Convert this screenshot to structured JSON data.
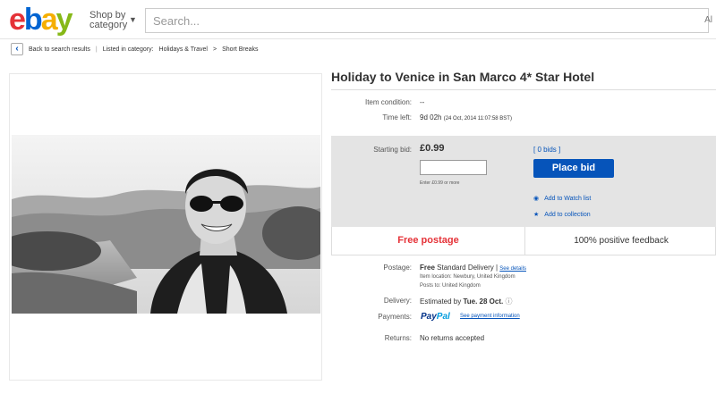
{
  "header": {
    "logo_letters": [
      {
        "ch": "e",
        "color": "#e53238"
      },
      {
        "ch": "b",
        "color": "#0064d2"
      },
      {
        "ch": "a",
        "color": "#f5af02"
      },
      {
        "ch": "y",
        "color": "#86b817"
      }
    ],
    "shop_by_line1": "Shop by",
    "shop_by_line2": "category",
    "search_placeholder": "Search...",
    "search_right": "Al"
  },
  "breadcrumb": {
    "back": "Back to search results",
    "listed_in": "Listed in category:",
    "cat1": "Holidays & Travel",
    "arrow": ">",
    "cat2": "Short Breaks"
  },
  "item": {
    "title": "Holiday to Venice in San Marco 4* Star Hotel",
    "condition_label": "Item condition:",
    "condition_value": "--",
    "time_left_label": "Time left:",
    "time_left_value": "9d 02h",
    "time_left_detail": "(24 Oct, 2014   11:07:58 BST)"
  },
  "bid": {
    "starting_label": "Starting bid:",
    "price": "£0.99",
    "bids_count": "[ 0 bids ]",
    "place_bid": "Place bid",
    "hint": "Enter £0.99 or more",
    "watch_link": "Add to Watch list",
    "collection_link": "Add to collection"
  },
  "promo": {
    "free_postage": "Free postage",
    "positive_feedback": "100% positive feedback"
  },
  "shipping": {
    "postage_label": "Postage:",
    "postage_free": "Free",
    "postage_method": "Standard Delivery",
    "postage_sep": "|",
    "see_details": "See details",
    "item_location": "Item location:  Newbury, United Kingdom",
    "posts_to": "Posts to:  United Kingdom",
    "delivery_label": "Delivery:",
    "delivery_prefix": "Estimated by",
    "delivery_date": "Tue. 28 Oct.",
    "payments_label": "Payments:",
    "paypal_a": "Pay",
    "paypal_b": "Pal",
    "see_payment": "See payment information",
    "returns_label": "Returns:",
    "returns_value": "No returns accepted"
  },
  "colors": {
    "accent_blue": "#0654ba",
    "free_postage_red": "#e53238",
    "bid_panel_bg": "#e4e4e4"
  },
  "icons": {
    "back": "chevron-left-icon",
    "watch": "eye-icon",
    "collection": "star-icon",
    "delivery_info": "info-icon"
  }
}
